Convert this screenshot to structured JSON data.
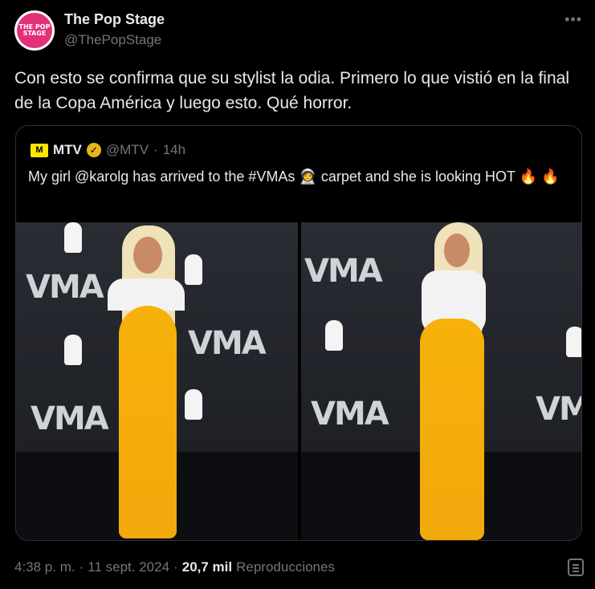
{
  "author": {
    "name": "The Pop Stage",
    "handle": "@ThePopStage",
    "avatar_text": "THE POP STAGE"
  },
  "tweet": {
    "text": "Con esto se confirma que su stylist la odia. Primero lo que vistió en la final de la Copa América y luego esto. Qué horror."
  },
  "quote": {
    "name": "MTV",
    "handle": "@MTV",
    "separator": "·",
    "time": "14h",
    "logo_text": "M",
    "text_part1": "My girl @karolg has arrived to the #VMAs",
    "text_part2": " carpet and she is looking HOT ",
    "emoji_astronaut": "🧑‍🚀",
    "emoji_fire": "🔥"
  },
  "footer": {
    "time": "4:38 p. m.",
    "sep1": "·",
    "date": "11 sept. 2024",
    "sep2": "·",
    "views_count": "20,7 mil",
    "views_label": "Reproducciones"
  },
  "icons": {
    "more": "more-icon",
    "verified": "verified-icon",
    "stats": "stats-icon"
  },
  "colors": {
    "background": "#000000",
    "text": "#e7e9ea",
    "muted": "#71767b",
    "border": "#2f3336",
    "verified": "#e2b719",
    "mtv_yellow": "#ffe600",
    "dress": "#f7b10a"
  }
}
